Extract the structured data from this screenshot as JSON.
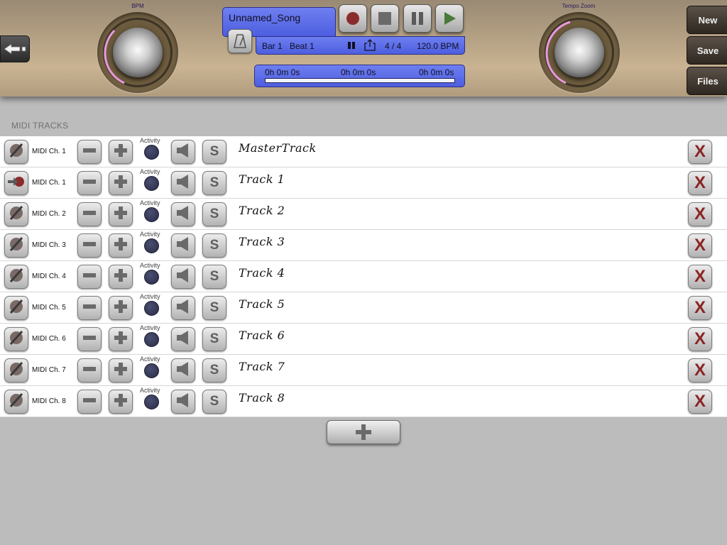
{
  "header": {
    "bpm_label": "BPM",
    "tempo_zoom_label": "Tempo Zoom",
    "song_title": "Unnamed_Song",
    "bar": "Bar 1",
    "beat": "Beat 1",
    "time_signature": "4 / 4",
    "tempo": "120.0 BPM",
    "time_start": "0h 0m 0s",
    "time_mid": "0h 0m 0s",
    "time_end": "0h 0m 0s",
    "transport_icons": [
      "record-icon",
      "stop-icon",
      "pause-icon",
      "play-icon"
    ],
    "side_buttons": [
      "New",
      "Save",
      "Files"
    ]
  },
  "tracks_section": {
    "title": "MIDI TRACKS",
    "activity_label": "Activity",
    "solo_label": "S",
    "delete_label": "X"
  },
  "tracks": [
    {
      "channel": "MIDI Ch. 1",
      "name": "MasterTrack",
      "input_icon": "midi-off-icon"
    },
    {
      "channel": "MIDI Ch. 1",
      "name": "Track 1",
      "input_icon": "midi-input-arrow-icon"
    },
    {
      "channel": "MIDI Ch. 2",
      "name": "Track 2",
      "input_icon": "midi-off-icon"
    },
    {
      "channel": "MIDI Ch. 3",
      "name": "Track 3",
      "input_icon": "midi-off-icon"
    },
    {
      "channel": "MIDI Ch. 4",
      "name": "Track 4",
      "input_icon": "midi-off-icon"
    },
    {
      "channel": "MIDI Ch. 5",
      "name": "Track 5",
      "input_icon": "midi-off-icon"
    },
    {
      "channel": "MIDI Ch. 6",
      "name": "Track 6",
      "input_icon": "midi-off-icon"
    },
    {
      "channel": "MIDI Ch. 7",
      "name": "Track 7",
      "input_icon": "midi-off-icon"
    },
    {
      "channel": "MIDI Ch. 8",
      "name": "Track 8",
      "input_icon": "midi-off-icon"
    }
  ],
  "colors": {
    "panel_blue": "#5b6ce8",
    "record_red": "#8a2424",
    "play_green": "#4a7a3a",
    "activity_dot": "#2f3352"
  }
}
